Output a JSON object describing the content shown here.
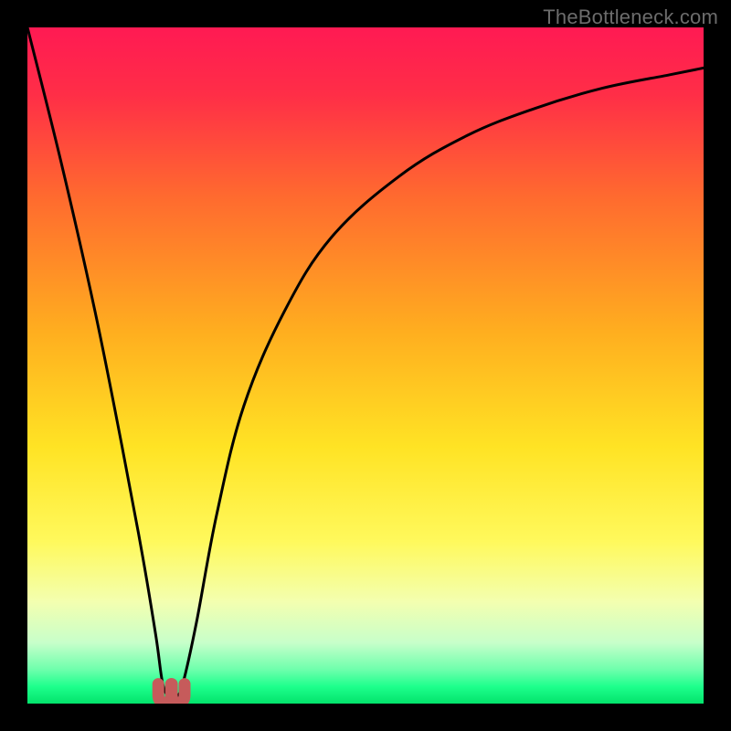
{
  "watermark": "TheBottleneck.com",
  "chart_data": {
    "type": "line",
    "title": "",
    "xlabel": "",
    "ylabel": "",
    "xlim": [
      0,
      100
    ],
    "ylim": [
      0,
      100
    ],
    "grid": false,
    "legend": false,
    "series": [
      {
        "name": "bottleneck-curve",
        "x": [
          0,
          5,
          10,
          14,
          17,
          19,
          20,
          21,
          22,
          23,
          25,
          28,
          32,
          38,
          45,
          55,
          65,
          75,
          85,
          95,
          100
        ],
        "values": [
          100,
          80,
          58,
          38,
          22,
          10,
          3,
          1,
          1,
          3,
          12,
          28,
          44,
          58,
          69,
          78,
          84,
          88,
          91,
          93,
          94
        ]
      }
    ],
    "markers": [
      {
        "name": "min-left",
        "shape": "rounded-U",
        "x": 20.3,
        "y": 1.0,
        "color": "#c65b5b"
      },
      {
        "name": "min-right",
        "shape": "rounded-U",
        "x": 22.3,
        "y": 1.0,
        "color": "#c65b5b"
      }
    ],
    "background_gradient": {
      "stops": [
        {
          "offset": 0.0,
          "color": "#ff1a53"
        },
        {
          "offset": 0.1,
          "color": "#ff2e47"
        },
        {
          "offset": 0.25,
          "color": "#ff6a2f"
        },
        {
          "offset": 0.45,
          "color": "#ffae1f"
        },
        {
          "offset": 0.62,
          "color": "#ffe324"
        },
        {
          "offset": 0.76,
          "color": "#fff95c"
        },
        {
          "offset": 0.85,
          "color": "#f3ffb0"
        },
        {
          "offset": 0.91,
          "color": "#c7ffca"
        },
        {
          "offset": 0.95,
          "color": "#6dffac"
        },
        {
          "offset": 0.975,
          "color": "#1dff8c"
        },
        {
          "offset": 1.0,
          "color": "#03e36b"
        }
      ]
    }
  }
}
